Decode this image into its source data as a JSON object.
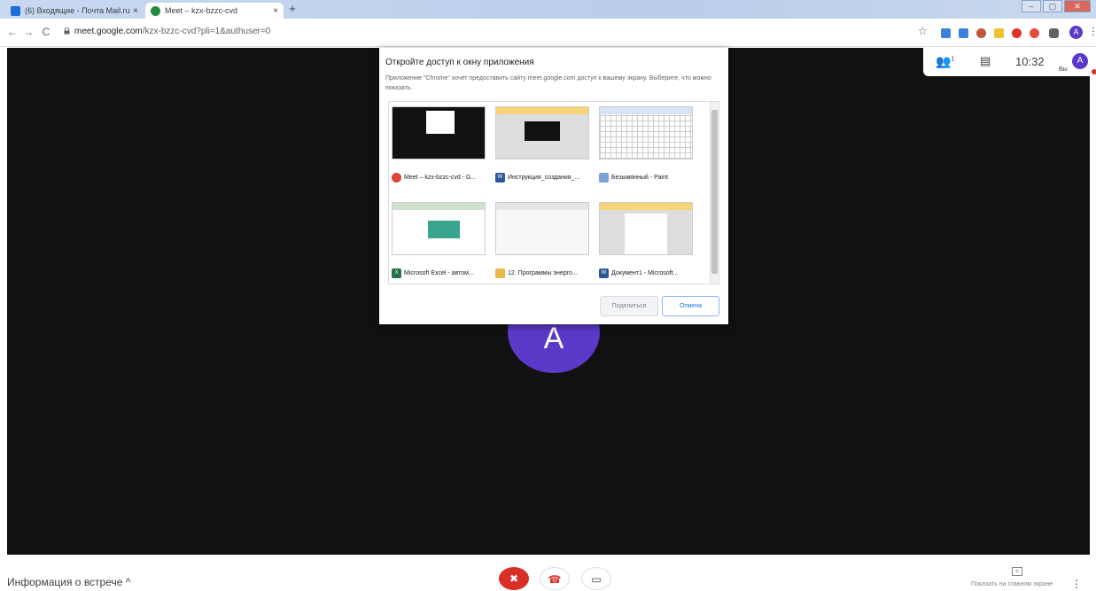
{
  "browser": {
    "tabs": [
      {
        "title": "(6) Входящие - Почта Mail.ru",
        "close": "×",
        "fav_color": "#1d6ed8"
      },
      {
        "title": "Meet – kzx-bzzc-cvd",
        "close": "×",
        "fav_color": "#1e8e3e"
      }
    ],
    "new_tab": "+",
    "url_host": "meet.google.com",
    "url_path": "/kzx-bzzc-cvd?pli=1&authuser=0",
    "back": "←",
    "forward": "→",
    "reload": "C",
    "lock": "🔒",
    "star": "☆",
    "profile_initial": "A",
    "menu": "⋮",
    "window_controls": {
      "minimize": "–",
      "maximize": "▢",
      "close": "✕"
    }
  },
  "meet": {
    "participant_initial": "A",
    "people_count": "1",
    "people_icon": "👥",
    "chat_icon": "▤",
    "time": "10:32",
    "you_label": "Вы",
    "self_initial": "A",
    "meeting_info": "Информация о встрече  ^",
    "controls": {
      "mic": "✖",
      "hangup": "☎",
      "camera": "▭"
    },
    "present_label": "Показать на главном экране",
    "present_icon": "+",
    "more": "⋮"
  },
  "dialog": {
    "title": "Откройте доступ к окну приложения",
    "text": "Приложение \"Chrome\" хочет предоставить сайту meet.google.com доступ к вашему экрану. Выберите, что можно показать.",
    "windows": [
      {
        "label": "Meet – kzx-bzzc-cvd - G...",
        "icon": "chrome-icon",
        "icon_color": "#db4437"
      },
      {
        "label": "Инструкция_создания_...",
        "icon": "word-icon",
        "icon_color": "#2b579a"
      },
      {
        "label": "Безымянный - Paint",
        "icon": "paint-icon",
        "icon_color": "#7aa3d8"
      },
      {
        "label": "Microsoft Excel - автом...",
        "icon": "excel-icon",
        "icon_color": "#217346"
      },
      {
        "label": "12. Программы энерго...",
        "icon": "folder-icon",
        "icon_color": "#e8b84a"
      },
      {
        "label": "Документ1 - Microsoft...",
        "icon": "word-icon",
        "icon_color": "#2b579a"
      }
    ],
    "share_button": "Поделиться",
    "cancel_button": "Отмена"
  }
}
